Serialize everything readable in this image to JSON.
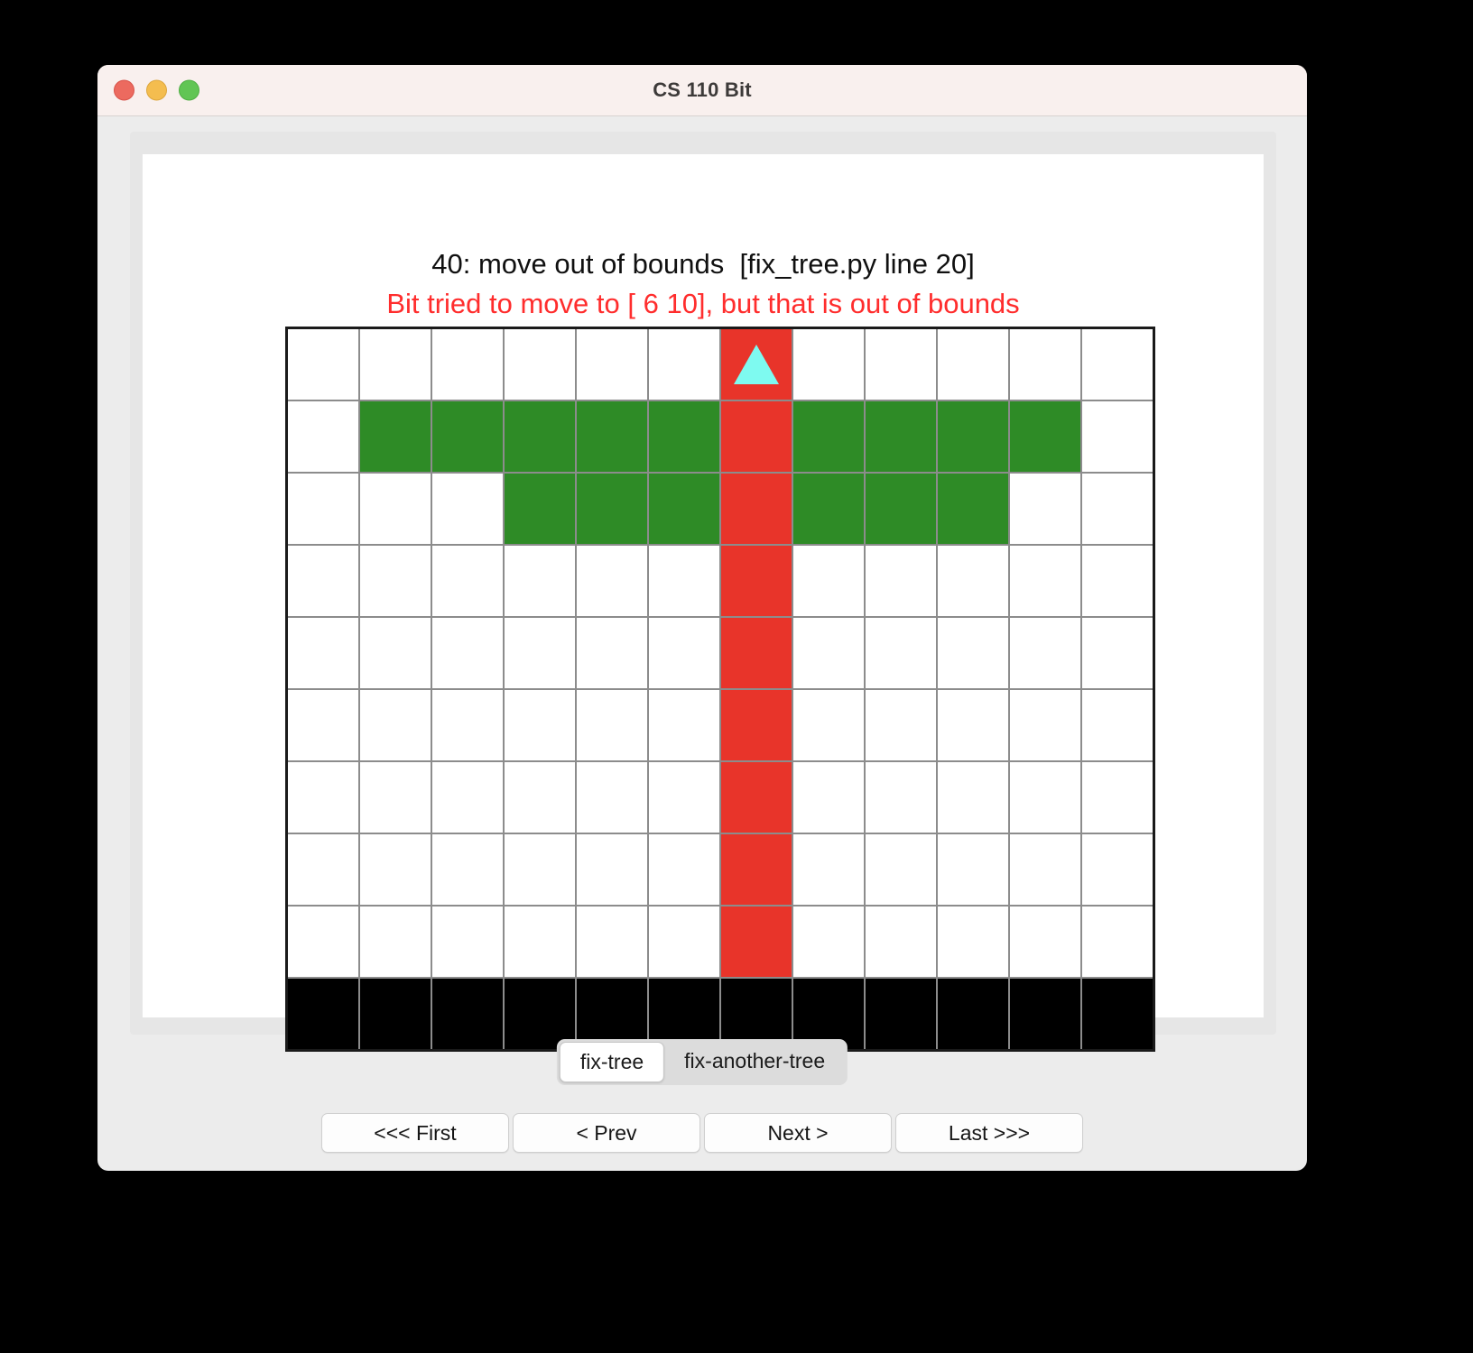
{
  "window": {
    "title": "CS 110 Bit",
    "traffic_lights": [
      "close-button",
      "minimize-button",
      "maximize-button"
    ]
  },
  "figure": {
    "title": "40: move out of bounds  [fix_tree.py line 20]",
    "subtitle": "Bit tried to move to [ 6 10], but that is out of bounds",
    "title_color": "#101010",
    "subtitle_color": "#ff2d2d"
  },
  "world": {
    "columns": 12,
    "rows": 10,
    "cell_size": 78,
    "colors": {
      "empty": "#ffffff",
      "green": "#2e8b26",
      "red": "#e8342a",
      "black": "#000000",
      "bit": "#7efaf0",
      "gridline": "#8c8c8c",
      "border": "#1a1a1a"
    },
    "bit": {
      "row": 0,
      "col": 6,
      "direction": "up",
      "shape": "triangle"
    },
    "cells": [
      [
        "w",
        "w",
        "w",
        "w",
        "w",
        "w",
        "r",
        "w",
        "w",
        "w",
        "w",
        "w"
      ],
      [
        "w",
        "g",
        "g",
        "g",
        "g",
        "g",
        "r",
        "g",
        "g",
        "g",
        "g",
        "w"
      ],
      [
        "w",
        "w",
        "w",
        "g",
        "g",
        "g",
        "r",
        "g",
        "g",
        "g",
        "w",
        "w"
      ],
      [
        "w",
        "w",
        "w",
        "w",
        "w",
        "w",
        "r",
        "w",
        "w",
        "w",
        "w",
        "w"
      ],
      [
        "w",
        "w",
        "w",
        "w",
        "w",
        "w",
        "r",
        "w",
        "w",
        "w",
        "w",
        "w"
      ],
      [
        "w",
        "w",
        "w",
        "w",
        "w",
        "w",
        "r",
        "w",
        "w",
        "w",
        "w",
        "w"
      ],
      [
        "w",
        "w",
        "w",
        "w",
        "w",
        "w",
        "r",
        "w",
        "w",
        "w",
        "w",
        "w"
      ],
      [
        "w",
        "w",
        "w",
        "w",
        "w",
        "w",
        "r",
        "w",
        "w",
        "w",
        "w",
        "w"
      ],
      [
        "w",
        "w",
        "w",
        "w",
        "w",
        "w",
        "r",
        "w",
        "w",
        "w",
        "w",
        "w"
      ],
      [
        "k",
        "k",
        "k",
        "k",
        "k",
        "k",
        "k",
        "k",
        "k",
        "k",
        "k",
        "k"
      ]
    ]
  },
  "tabs": [
    {
      "label": "fix-tree",
      "active": true
    },
    {
      "label": "fix-another-tree",
      "active": false
    }
  ],
  "nav_buttons": [
    {
      "label": "<<< First",
      "name": "first-button"
    },
    {
      "label": "< Prev",
      "name": "prev-button"
    },
    {
      "label": "Next >",
      "name": "next-button"
    },
    {
      "label": "Last >>>",
      "name": "last-button"
    }
  ]
}
